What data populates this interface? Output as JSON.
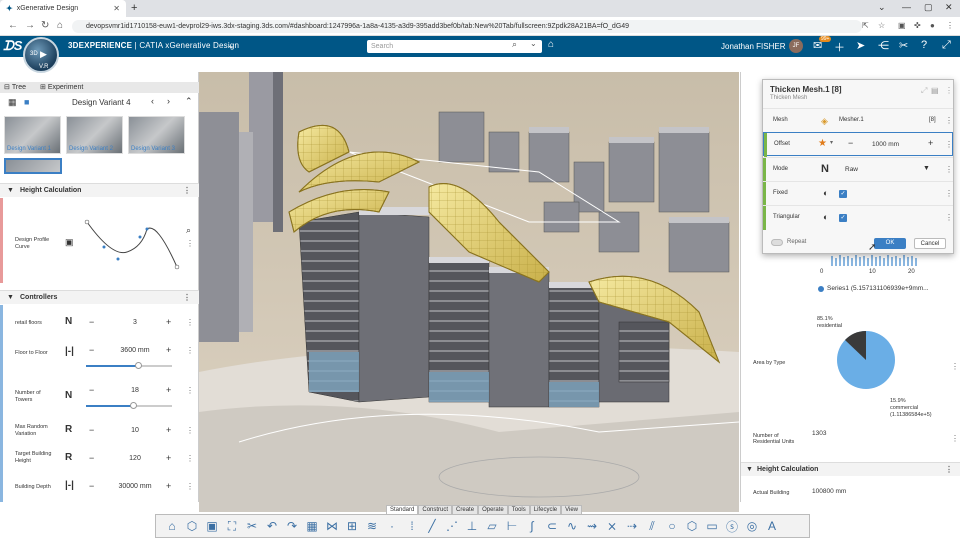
{
  "browser": {
    "tab_title": "xGenerative Design",
    "new_tab": "+",
    "url": "devopsvmr1id1710158-euw1-devprol29-iws.3dx-staging.3ds.com/#dashboard:1247996a-1a8a-4135-a3d9-395add3bef0b/tab:New%20Tab/fullscreen:9Zpdk28A21BA=fO_dG49"
  },
  "app": {
    "brand": "3D",
    "title_bold": "3DEXPERIENCE",
    "title_rest": " | CATIA  xGenerative Design",
    "compass": {
      "top": "3D",
      "v": "V.R"
    },
    "search_placeholder": "Search",
    "user_name": "Jonathan FISHER",
    "avatar_initials": "JF",
    "notification_count": "99+"
  },
  "left_panel": {
    "tabs": [
      "Tree",
      "Experiment"
    ],
    "variant_title": "Design Variant 4",
    "thumbnails": [
      "Design Variant 1",
      "Design Variant 2",
      "Design Variant 3"
    ],
    "height_calc": {
      "title": "Height Calculation",
      "curve_label": "Design Profile Curve"
    },
    "controllers": {
      "title": "Controllers",
      "rows": [
        {
          "label": "retail floors",
          "icon": "N",
          "value": "3"
        },
        {
          "label": "Floor to Floor",
          "icon": "|-|",
          "value": "3600 mm",
          "slider": 0.6
        },
        {
          "label": "Number of Towers",
          "icon": "N",
          "value": "18",
          "slider": 0.55
        },
        {
          "label": "Max Random Variation",
          "icon": "R",
          "value": "10"
        },
        {
          "label": "Target Building Height",
          "icon": "R",
          "value": "120"
        },
        {
          "label": "Building Depth",
          "icon": "|-|",
          "value": "30000 mm"
        }
      ]
    }
  },
  "dialog": {
    "title": "Thicken Mesh.1 [8]",
    "subtitle": "Thicken Mesh",
    "rows": {
      "mesh_label": "Mesh",
      "mesh_value": "Mesher.1",
      "mesh_count": "[8]",
      "offset_label": "Offset",
      "offset_value": "1000 mm",
      "mode_label": "Mode",
      "mode_value": "Raw",
      "fixed_label": "Fixed",
      "triangular_label": "Triangular"
    },
    "repeat_label": "Repeat",
    "ok": "OK",
    "cancel": "Cancel"
  },
  "right_panel": {
    "series_label": "Series1 (5.157131106939e+9mm...",
    "area_by_type": "Area by Type",
    "pie": {
      "residential_pct": "85.1%",
      "residential_label": "residential",
      "commercial_pct": "15.9%",
      "commercial_label": "commercial",
      "commercial_value": "(1.11386584e+5)"
    },
    "units_label": "Number of Residential Units",
    "units_value": "1303",
    "height_calc_title": "Height Calculation",
    "actual_height_label": "Actual Building",
    "actual_height_value": "100800 mm",
    "axis_ticks": [
      "0",
      "10",
      "20"
    ]
  },
  "bottom": {
    "tabs": [
      "Standard",
      "Construct",
      "Create",
      "Operate",
      "Tools",
      "Lifecycle",
      "View"
    ]
  },
  "colors": {
    "header": "#005686",
    "accent": "#3b7fc4",
    "green": "#7ab648"
  }
}
